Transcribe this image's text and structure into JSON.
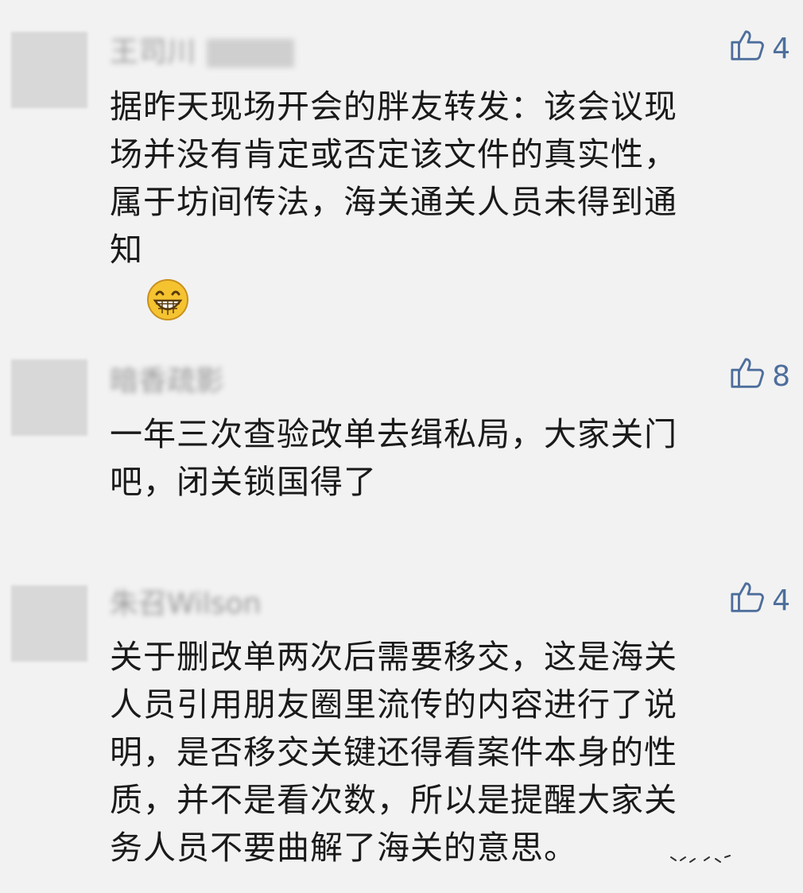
{
  "comments": [
    {
      "name": "王司川",
      "likes": "4",
      "text": "据昨天现场开会的胖友转发：该会议现\n场并没有肯定或否定该文件的真实性，\n属于坊间传法，海关通关人员未得到通\n知",
      "emoji": "grinning-face-icon"
    },
    {
      "name": "暗香疏影",
      "likes": "8",
      "text": "一年三次查验改单去缉私局，大家关门\n吧，闭关锁国得了"
    },
    {
      "name": "朱召Wilson",
      "likes": "4",
      "text": "关于删改单两次后需要移交，这是海关\n人员引用朋友圈里流传的内容进行了说\n明，是否移交关键还得看案件本身的性\n质，并不是看次数，所以是提醒大家关\n务人员不要曲解了海关的意思。"
    }
  ],
  "colors": {
    "background": "#f2f2f2",
    "like": "#4d6e9c",
    "text": "#1a1a1a"
  },
  "icons": {
    "like": "thumbs-up-icon",
    "emoji": "grinning-face-icon"
  }
}
